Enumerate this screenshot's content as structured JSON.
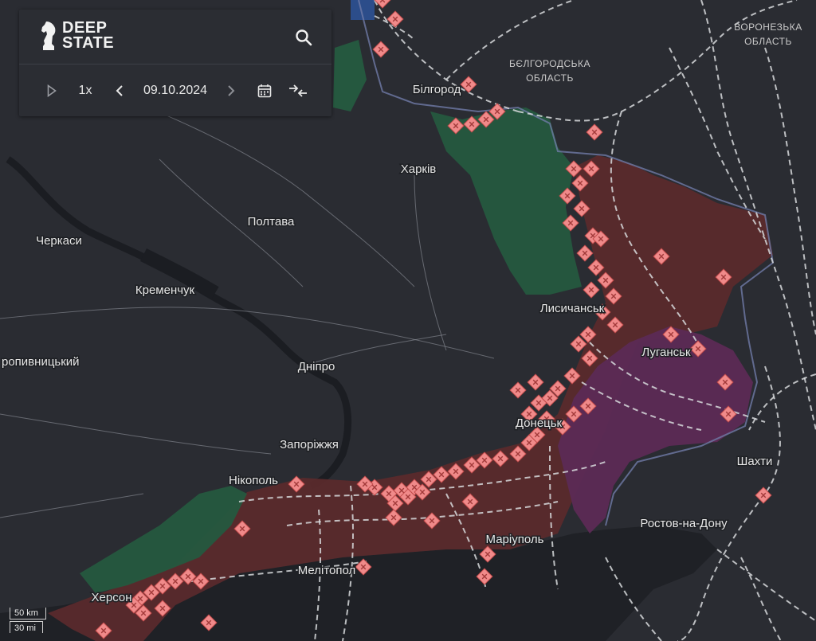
{
  "app": {
    "logo_line1": "DEEP",
    "logo_line2": "STATE"
  },
  "timeline": {
    "speed": "1x",
    "date": "09.10.2024"
  },
  "icons": {
    "search": "search-icon",
    "play": "play-icon",
    "prev": "chevron-left-icon",
    "next": "chevron-right-icon",
    "calendar": "calendar-icon",
    "compare": "compare-arrows-icon"
  },
  "colors": {
    "occupied": "#5a2a2c",
    "pre2022": "#5c2a55",
    "liberated": "#25583f",
    "markers": "#f08a8a"
  },
  "map": {
    "cities": {
      "kharkiv": "Харків",
      "poltava": "Полтава",
      "cherkasy": "Черкаси",
      "kremenchuk": "Кременчук",
      "kropyvnytskyi": "ропивницький",
      "dnipro": "Дніпро",
      "zaporizhzhia": "Запоріжжя",
      "nikopol": "Нікополь",
      "melitopol": "Мелітопол",
      "kherson": "Херсон",
      "mariupol": "Маріуполь",
      "rostov": "Ростов-на-Дону",
      "shakhty": "Шахти",
      "luhansk": "Луганськ",
      "lysychansk": "Лисичанськ",
      "donetsk": "Донецьк",
      "belgorod": "Білгород"
    },
    "regions": {
      "belgorod_l1": "БЄЛГОРОДСЬКА",
      "belgorod_l2": "ОБЛАСТЬ",
      "voronezh_l1": "ВОРОНЕЗЬКА",
      "voronezh_l2": "ОБЛАСТЬ"
    }
  },
  "scale": {
    "km": "50 km",
    "mi": "30 mi"
  }
}
